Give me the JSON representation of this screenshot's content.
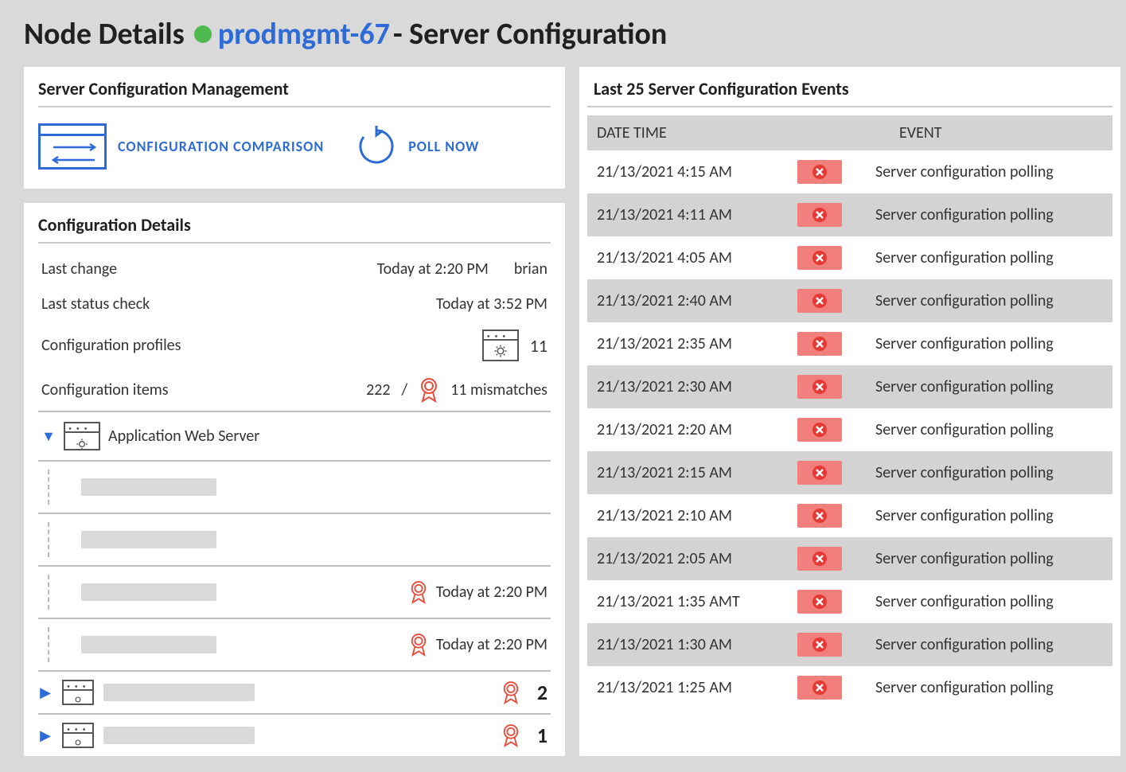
{
  "header": {
    "prefix": "Node Details",
    "node": "prodmgmt-67",
    "suffix": " - Server Configuration",
    "status": "up",
    "status_color": "#4fb84f",
    "accent_color": "#2f6bd6"
  },
  "mgmt": {
    "title": "Server Configuration Management",
    "compare_label": "CONFIGURATION COMPARISON",
    "poll_label": "POLL NOW"
  },
  "details": {
    "title": "Configuration Details",
    "rows": {
      "last_change_label": "Last change",
      "last_change_value": "Today at 2:20 PM",
      "last_change_user": "brian",
      "last_status_label": "Last status check",
      "last_status_value": "Today at 3:52 PM",
      "profiles_label": "Configuration profiles",
      "profiles_count": "11",
      "items_label": "Configuration items",
      "items_total": "222",
      "items_mismatches": "11 mismatches"
    },
    "tree": {
      "root_label": "Application Web Server",
      "children": [
        {
          "time": ""
        },
        {
          "time": ""
        },
        {
          "time": "Today at 2:20 PM"
        },
        {
          "time": "Today at 2:20 PM"
        }
      ],
      "siblings": [
        {
          "count": "2"
        },
        {
          "count": "1"
        }
      ]
    }
  },
  "events": {
    "title": "Last 25 Server Configuration Events",
    "col_datetime": "DATE TIME",
    "col_event": "EVENT",
    "rows": [
      {
        "dt": "21/13/2021  4:15 AM",
        "msg": "Server configuration polling"
      },
      {
        "dt": "21/13/2021  4:11 AM",
        "msg": "Server configuration polling"
      },
      {
        "dt": "21/13/2021  4:05 AM",
        "msg": "Server configuration polling"
      },
      {
        "dt": "21/13/2021  2:40 AM",
        "msg": "Server configuration polling"
      },
      {
        "dt": "21/13/2021  2:35 AM",
        "msg": "Server configuration polling"
      },
      {
        "dt": "21/13/2021  2:30 AM",
        "msg": "Server configuration polling"
      },
      {
        "dt": "21/13/2021  2:20 AM",
        "msg": "Server configuration polling"
      },
      {
        "dt": "21/13/2021  2:15 AM",
        "msg": "Server configuration polling"
      },
      {
        "dt": "21/13/2021 2:10 AM",
        "msg": "Server configuration polling"
      },
      {
        "dt": "21/13/2021 2:05 AM",
        "msg": "Server configuration polling"
      },
      {
        "dt": "21/13/2021 1:35 AMT",
        "msg": "Server configuration polling"
      },
      {
        "dt": "21/13/2021 1:30 AM",
        "msg": "Server configuration polling"
      },
      {
        "dt": "21/13/2021 1:25 AM",
        "msg": "Server configuration polling"
      }
    ]
  }
}
